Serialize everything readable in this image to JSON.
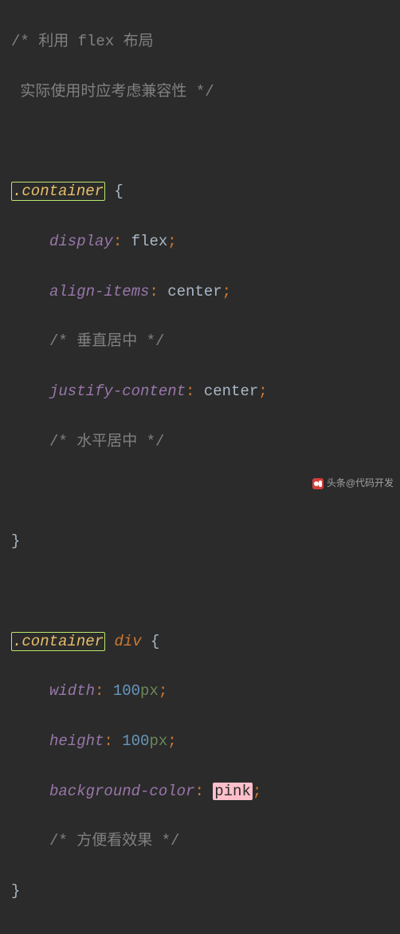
{
  "code": {
    "c1a": "/* 利用 flex 布局",
    "c1b": " 实际使用时应考虑兼容性 */",
    "sel1": ".container",
    "brace_open": " {",
    "p_display": "display",
    "v_flex": "flex",
    "p_align": "align-items",
    "v_center": "center",
    "c_vcenter": "/* 垂直居中 */",
    "p_justify": "justify-content",
    "c_hcenter": "/* 水平居中 */",
    "brace_close": "}",
    "sel2_class": ".container",
    "sel2_tag": "div",
    "p_width": "width",
    "v_100": "100",
    "u_px": "px",
    "p_height": "height",
    "p_bg": "background-color",
    "v_pink": "pink",
    "c_effect": "/* 方便看效果 */",
    "colon": ": ",
    "semi": ";"
  },
  "watermark": {
    "text": "头条@代码开发"
  }
}
